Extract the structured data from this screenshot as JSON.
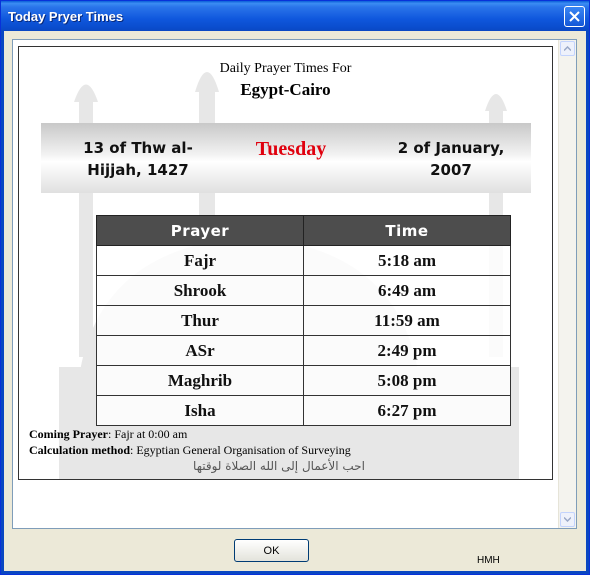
{
  "window": {
    "title": "Today Pryer Times"
  },
  "header": {
    "line1": "Daily Prayer Times For",
    "location": "Egypt-Cairo"
  },
  "dates": {
    "hijri": "13 of Thw al-Hijjah, 1427",
    "weekday": "Tuesday",
    "gregorian": "2 of January, 2007"
  },
  "table": {
    "headers": [
      "Prayer",
      "Time"
    ],
    "rows": [
      {
        "prayer": "Fajr",
        "time": "5:18 am"
      },
      {
        "prayer": "Shrook",
        "time": "6:49 am"
      },
      {
        "prayer": "Thur",
        "time": "11:59 am"
      },
      {
        "prayer": "ASr",
        "time": "2:49 pm"
      },
      {
        "prayer": "Maghrib",
        "time": "5:08 pm"
      },
      {
        "prayer": "Isha",
        "time": "6:27 pm"
      }
    ]
  },
  "footer": {
    "coming_label": "Coming Prayer",
    "coming_value": ": Fajr at 0:00 am",
    "calc_label": "Calculation method",
    "calc_value": ": Egyptian General Organisation of Surveying",
    "arabic_quote": "احب الأعمال إلى الله الصلاة لوقتها"
  },
  "buttons": {
    "ok": "OK"
  },
  "author": "HMH",
  "colors": {
    "weekday": "#e0000e",
    "table_header": "#4d4d4d",
    "title_bar": "#0a4ccc"
  }
}
